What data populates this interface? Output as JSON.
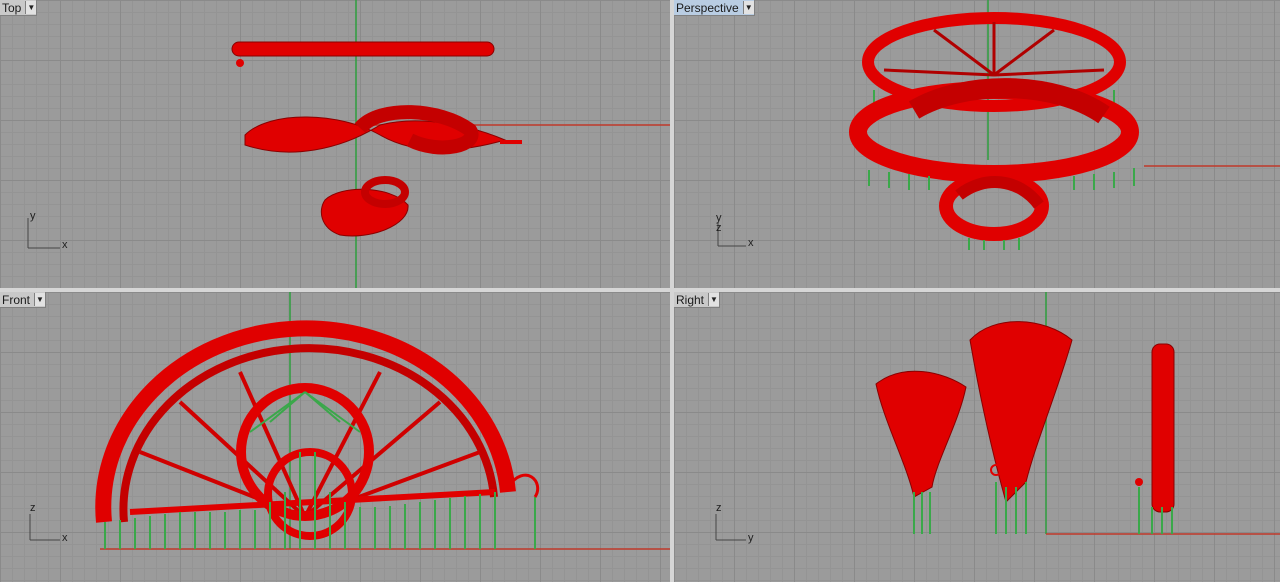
{
  "viewports": {
    "top": {
      "label": "Top",
      "axis_h": "x",
      "axis_v": "y"
    },
    "perspective": {
      "label": "Perspective",
      "axis_h": "x",
      "axis_v": "y",
      "axis_z": "z"
    },
    "front": {
      "label": "Front",
      "axis_h": "x",
      "axis_v": "z"
    },
    "right": {
      "label": "Right",
      "axis_h": "y",
      "axis_v": "z"
    }
  },
  "icons": {
    "dropdown": "triangle-down-icon"
  },
  "colors": {
    "viewport_bg": "#9b9b9b",
    "model_red": "#e00000",
    "support_green": "#3aa84a",
    "axis_x": "#c0392b",
    "axis_y": "#2e9e3e",
    "active_label": "#b9cde3"
  }
}
